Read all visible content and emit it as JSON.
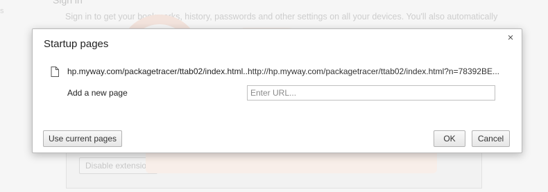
{
  "background": {
    "heading": "Sign in",
    "text": "Sign in to get your bookmarks, history, passwords and other settings on all your devices. You'll also automatically",
    "side_marker": "s",
    "button_label": "Disable extension"
  },
  "dialog": {
    "title": "Startup pages",
    "close_glyph": "×",
    "pages": [
      {
        "title": "hp.myway.com/packagetracer/ttab02/index.html...",
        "url": "http://hp.myway.com/packagetracer/ttab02/index.html?n=78392BE..."
      }
    ],
    "add_page_label": "Add a new page",
    "url_input": {
      "value": "",
      "placeholder": "Enter URL..."
    },
    "buttons": {
      "use_current": "Use current pages",
      "ok": "OK",
      "cancel": "Cancel"
    }
  },
  "icons": {
    "page": "document-icon",
    "close": "close-icon"
  },
  "colors": {
    "dialog_bg": "#ffffff",
    "border": "#b9b9b9",
    "text": "#222222",
    "watermark": "#f0e0d8"
  }
}
